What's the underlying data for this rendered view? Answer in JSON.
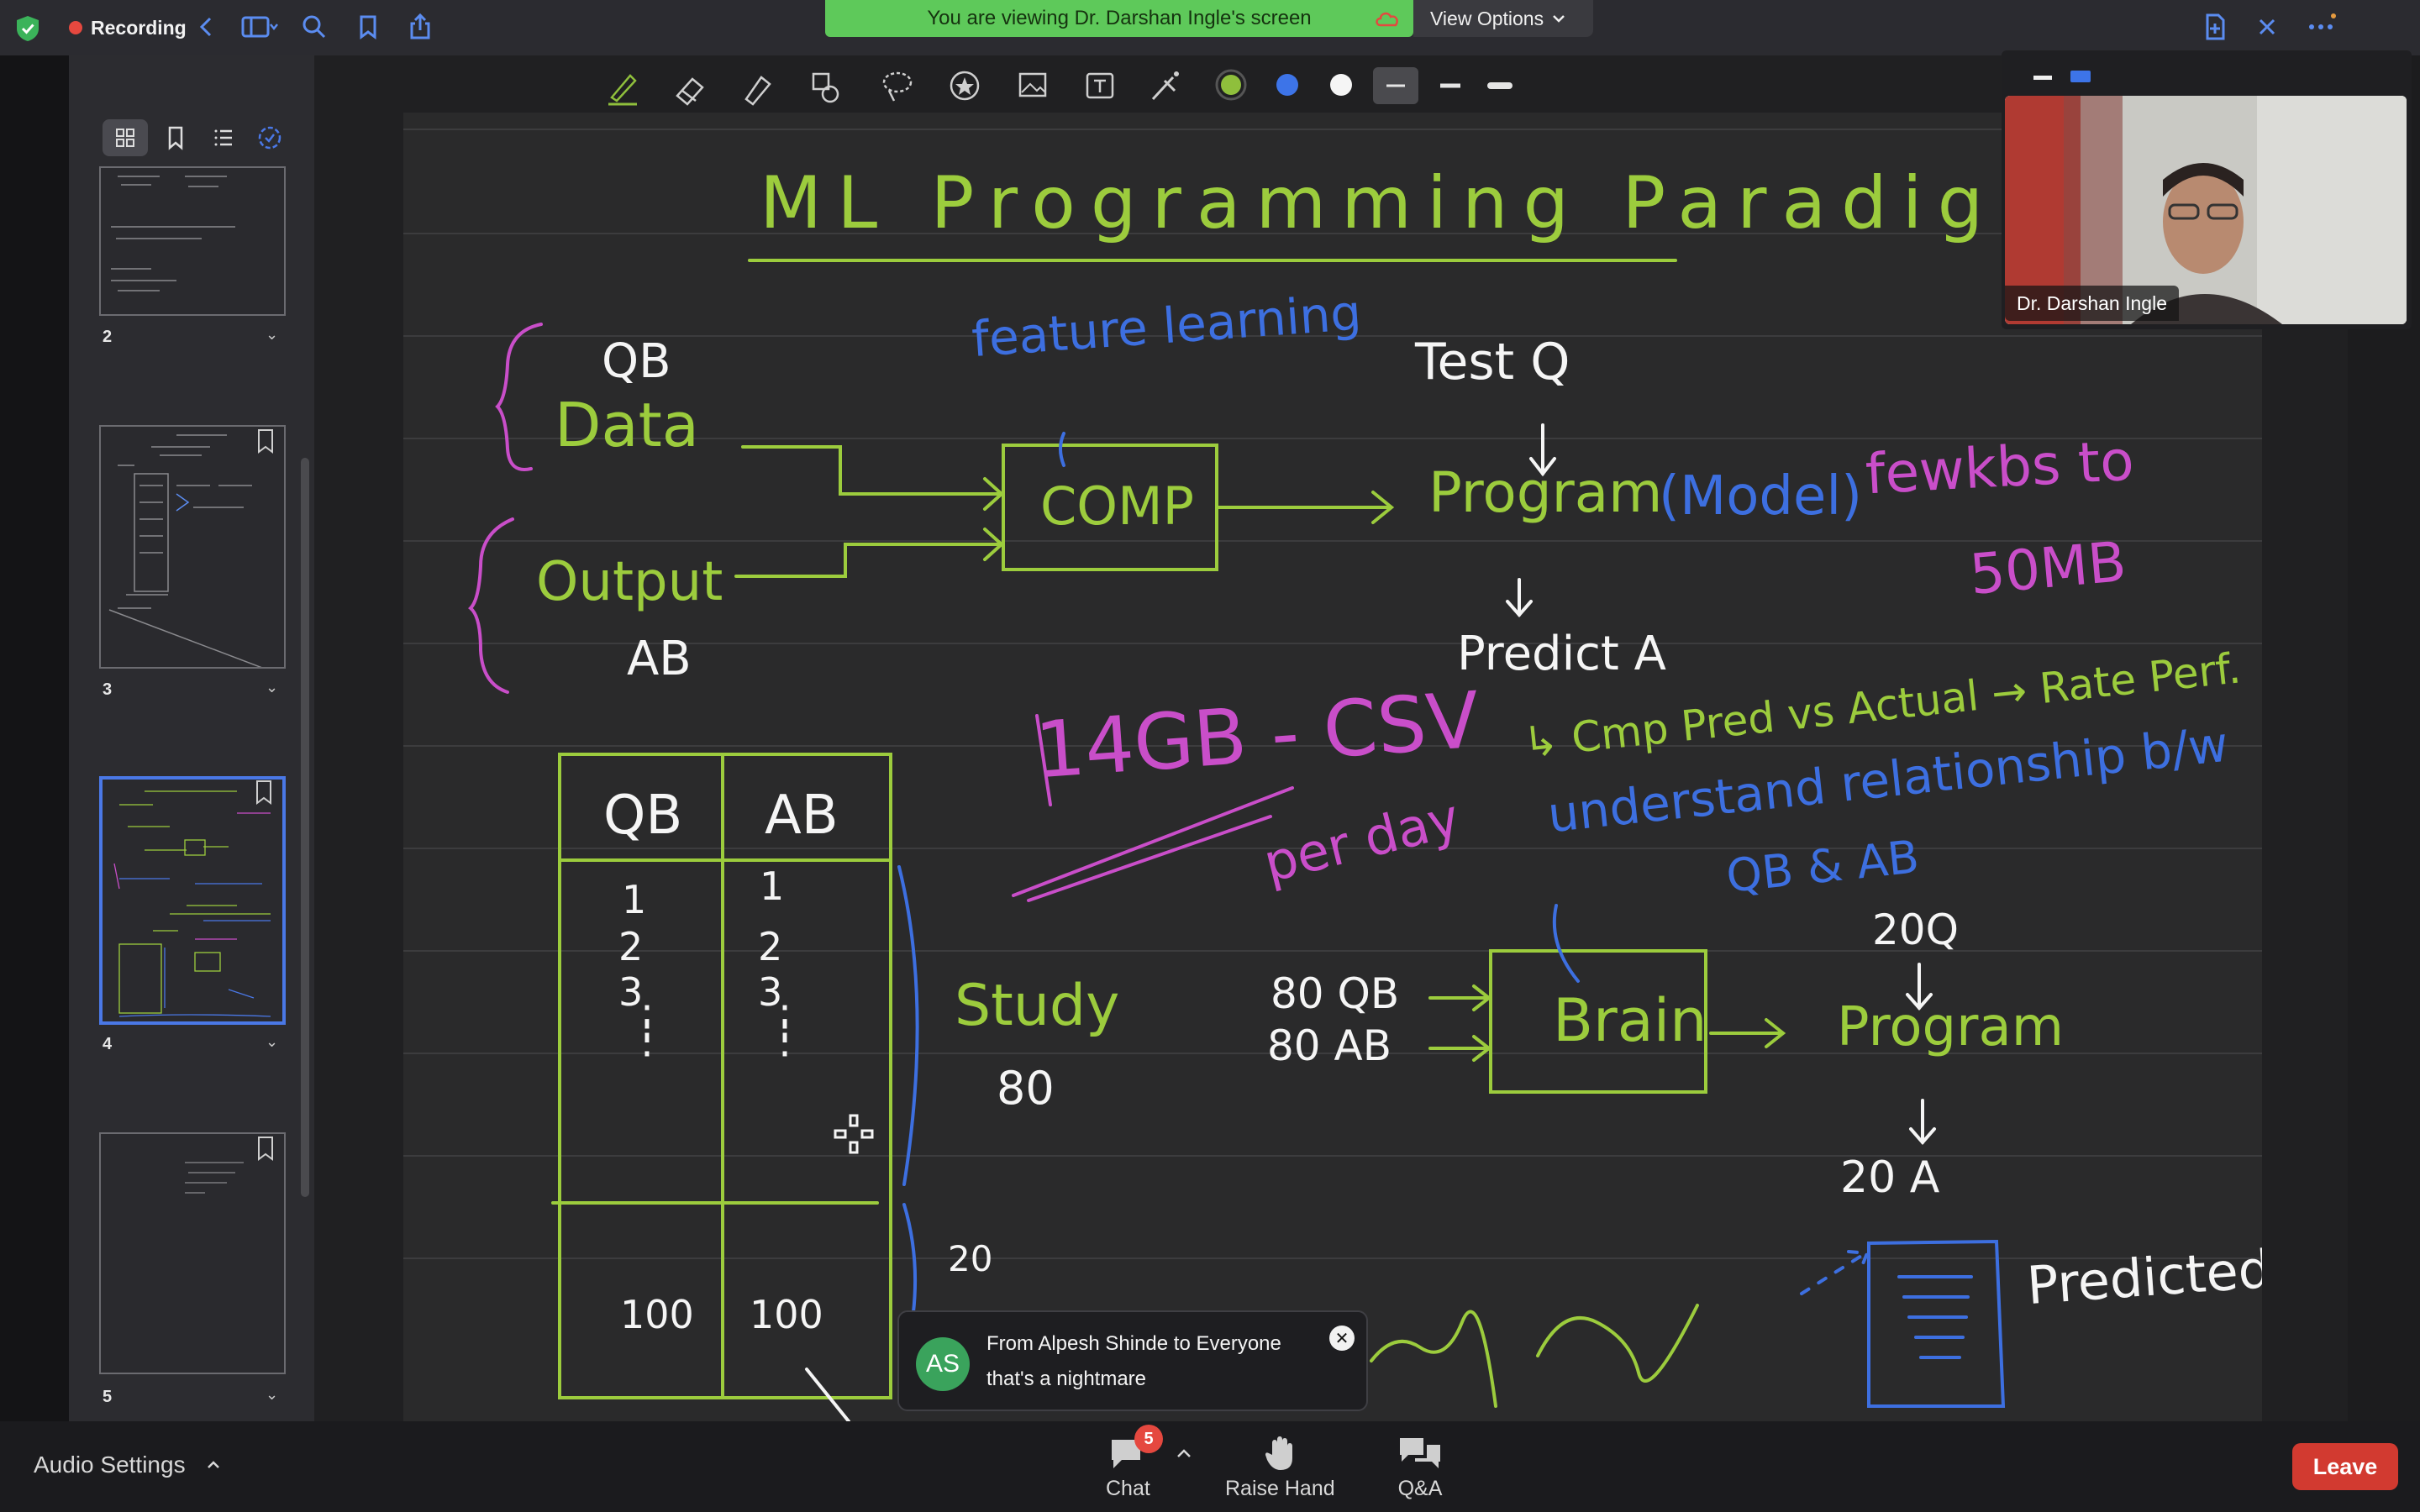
{
  "topbar": {
    "recording_label": "Recording",
    "banner_text": "You are viewing Dr. Darshan Ingle's screen",
    "view_options_label": "View Options"
  },
  "thumbnails": [
    {
      "page": "2"
    },
    {
      "page": "3"
    },
    {
      "page": "4",
      "active": true
    },
    {
      "page": "5"
    }
  ],
  "whiteboard": {
    "title": "ML Programming Paradigm",
    "feature_learning": "feature learning",
    "test_q": "Test Q",
    "qb": "QB",
    "data": "Data",
    "output": "Output",
    "ab": "AB",
    "comp": "COMP",
    "program_model": "Program",
    "model": "(Model)",
    "few_kbs": "fewkbs to",
    "fifty_mb": "50MB",
    "predict_a": "Predict A",
    "cmp_line": "↳ Cmp Pred vs Actual → Rate Perf.",
    "understand": "understand relationship b/w",
    "qb_ab": "QB & AB",
    "csv": "14GB - CSV",
    "per_day": "per day",
    "table_head_qb": "QB",
    "table_head_ab": "AB",
    "table_rows_qb": [
      "1",
      "2",
      "3"
    ],
    "table_rows_ab": [
      "1",
      "2",
      "3"
    ],
    "table_last_qb": "100",
    "table_last_ab": "100",
    "study": "Study",
    "eighty": "80",
    "twenty": "20",
    "twenty_q": "20Q",
    "eighty_qb": "80 QB",
    "eighty_ab": "80 AB",
    "brain": "Brain",
    "program2": "Program",
    "twenty_a": "20 A",
    "predicted": "Predicted"
  },
  "video": {
    "participant_name": "Dr. Darshan Ingle"
  },
  "toast": {
    "avatar_initials": "AS",
    "title": "From Alpesh Shinde to Everyone",
    "message": "that's a nightmare"
  },
  "bottombar": {
    "audio_settings": "Audio Settings",
    "chat_label": "Chat",
    "chat_badge": "5",
    "raise_hand_label": "Raise Hand",
    "qa_label": "Q&A",
    "leave_label": "Leave"
  },
  "colors": {
    "green_ink": "#9ccc3d",
    "blue_ink": "#3d6fe0",
    "pink_ink": "#c94ec9",
    "white_ink": "#f5f5f5",
    "banner": "#5ec95a",
    "leave": "#d23a30"
  }
}
